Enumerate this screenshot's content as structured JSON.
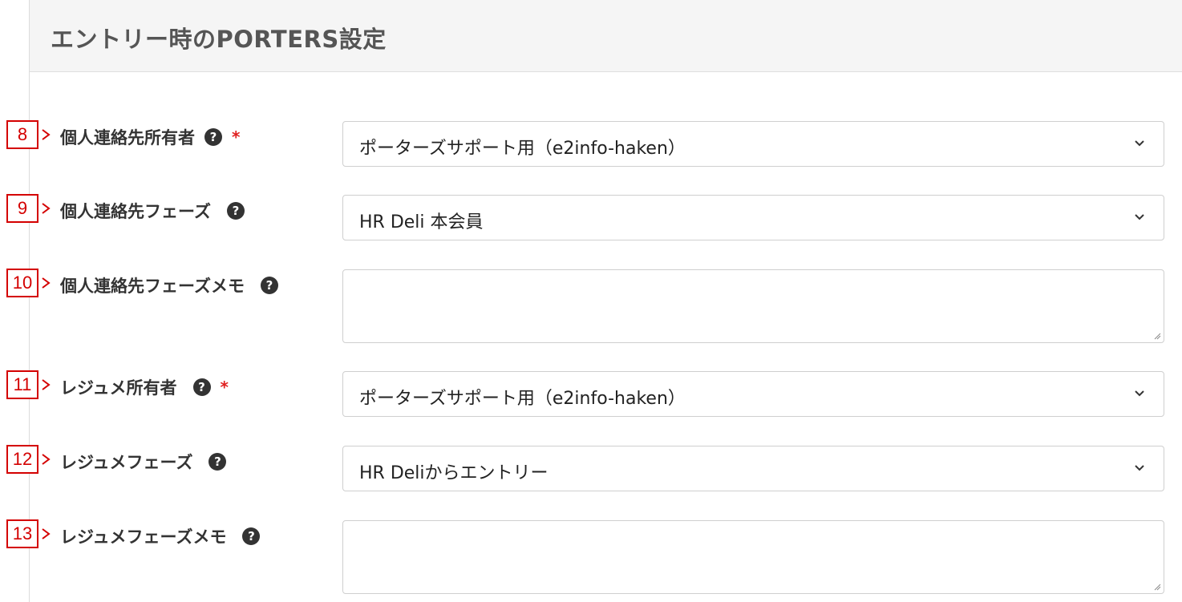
{
  "header": {
    "title": "エントリー時のPORTERS設定"
  },
  "fields": [
    {
      "marker": "8",
      "label": "個人連絡先所有者",
      "required_mark": "*",
      "value": "ポーターズサポート用（e2info-haken）"
    },
    {
      "marker": "9",
      "label": "個人連絡先フェーズ",
      "value": "HR Deli 本会員"
    },
    {
      "marker": "10",
      "label": "個人連絡先フェーズメモ",
      "value": ""
    },
    {
      "marker": "11",
      "label": "レジュメ所有者",
      "required_mark": "*",
      "value": "ポーターズサポート用（e2info-haken）"
    },
    {
      "marker": "12",
      "label": "レジュメフェーズ",
      "value": "HR Deliからエントリー"
    },
    {
      "marker": "13",
      "label": "レジュメフェーズメモ",
      "value": ""
    }
  ],
  "icons": {
    "help": "question-circle-icon",
    "dropdown": "chevron-down-icon",
    "resize": "resize-handle-icon",
    "help_glyph": "?"
  },
  "colors": {
    "marker_red": "#d40000",
    "required_red": "#e02020",
    "header_bg": "#f5f5f5"
  }
}
